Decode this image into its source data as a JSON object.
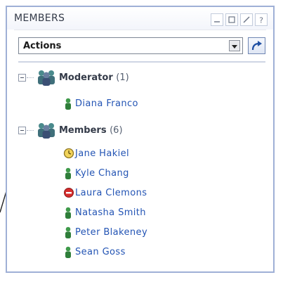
{
  "panel": {
    "title": "MEMBERS",
    "window_buttons": [
      {
        "name": "minimize-button",
        "icon": "minimize-icon"
      },
      {
        "name": "restore-button",
        "icon": "restore-icon"
      },
      {
        "name": "edit-button",
        "icon": "pencil-icon"
      },
      {
        "name": "help-button",
        "icon": "help-icon"
      }
    ]
  },
  "actions": {
    "selected": "Actions",
    "go_icon": "go-arrow-icon"
  },
  "groups": [
    {
      "label": "Moderator",
      "count": "(1)",
      "icon": "group-people-icon",
      "members": [
        {
          "name": "Diana Franco",
          "status": "online",
          "status_color": "#3f9a4a"
        }
      ]
    },
    {
      "label": "Members",
      "count": "(6)",
      "icon": "group-people-icon",
      "members": [
        {
          "name": "Jane Hakiel",
          "status": "away",
          "status_color": "#c8a21f"
        },
        {
          "name": "Kyle Chang",
          "status": "online",
          "status_color": "#3f9a4a"
        },
        {
          "name": "Laura Clemons",
          "status": "do-not-disturb",
          "status_color": "#d52c2c"
        },
        {
          "name": "Natasha Smith",
          "status": "online",
          "status_color": "#3f9a4a"
        },
        {
          "name": "Peter Blakeney",
          "status": "online",
          "status_color": "#3f9a4a"
        },
        {
          "name": "Sean Goss",
          "status": "online",
          "status_color": "#3f9a4a"
        }
      ]
    }
  ],
  "colors": {
    "member_link": "#2354b4",
    "panel_border": "#9fb0d6"
  }
}
